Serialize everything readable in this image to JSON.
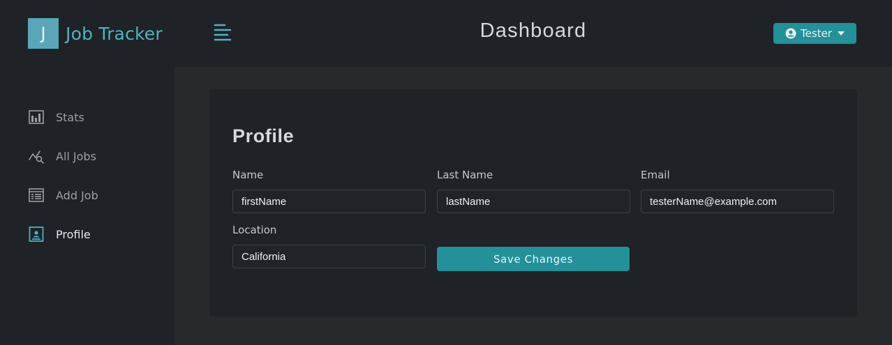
{
  "brand": {
    "logo_letter": "J",
    "name": "Job Tracker"
  },
  "header": {
    "title": "Dashboard",
    "user_label": "Tester"
  },
  "sidebar": {
    "items": [
      {
        "label": "Stats",
        "icon": "bar-chart-icon"
      },
      {
        "label": "All Jobs",
        "icon": "chart-search-icon"
      },
      {
        "label": "Add Job",
        "icon": "form-icon"
      },
      {
        "label": "Profile",
        "icon": "id-card-icon",
        "active": true
      }
    ]
  },
  "profile": {
    "title": "Profile",
    "fields": {
      "name": {
        "label": "Name",
        "value": "firstName"
      },
      "last_name": {
        "label": "Last Name",
        "value": "lastName"
      },
      "email": {
        "label": "Email",
        "value": "testerName@example.com"
      },
      "location": {
        "label": "Location",
        "value": "California"
      }
    },
    "save_label": "Save Changes"
  },
  "colors": {
    "accent": "#23909a",
    "brand_text": "#4fb2c4",
    "background": "#1f2226",
    "content_bg": "#262a2d"
  }
}
